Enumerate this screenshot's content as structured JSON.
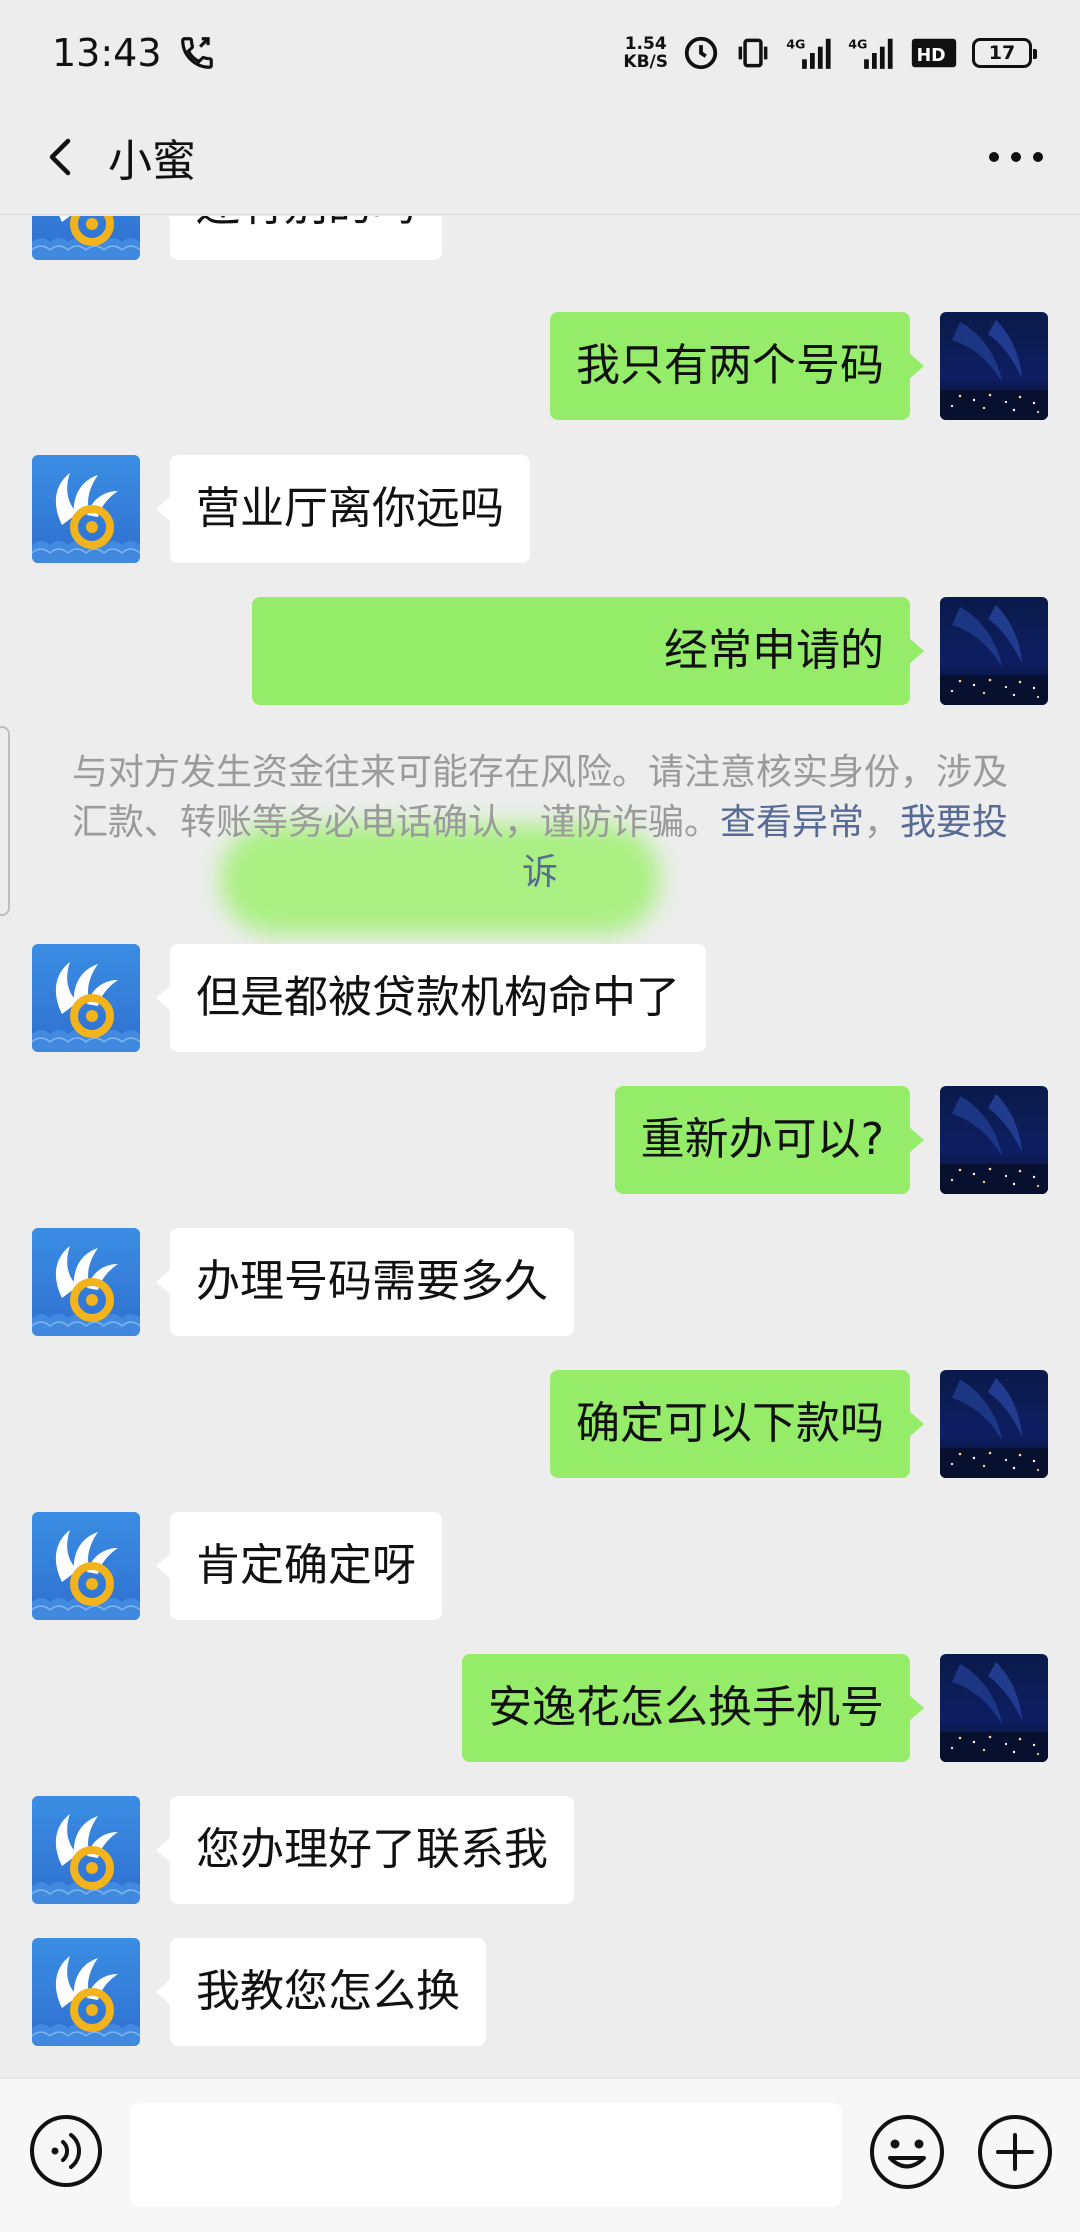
{
  "status_bar": {
    "time": "13:43",
    "net_speed_value": "1.54",
    "net_speed_unit": "KB/S",
    "sim1": "4G",
    "sim2": "4G",
    "hd": "HD",
    "battery": "17"
  },
  "header": {
    "title": "小蜜",
    "back_icon": "chevron-left-icon",
    "more_icon": "ellipsis-icon"
  },
  "messages": [
    {
      "side": "left",
      "text": "还有别的吗"
    },
    {
      "side": "right",
      "text": "我只有两个号码"
    },
    {
      "side": "left",
      "text": "营业厅离你远吗"
    },
    {
      "side": "right",
      "text": "经常申请的",
      "partially_blurred": true
    },
    {
      "side": "left",
      "text": "但是都被贷款机构命中了"
    },
    {
      "side": "right",
      "text": "重新办可以?"
    },
    {
      "side": "left",
      "text": "办理号码需要多久"
    },
    {
      "side": "right",
      "text": "确定可以下款吗"
    },
    {
      "side": "left",
      "text": "肯定确定呀"
    },
    {
      "side": "right",
      "text": "安逸花怎么换手机号"
    },
    {
      "side": "left",
      "text": "您办理好了联系我"
    },
    {
      "side": "left",
      "text": "我教您怎么换"
    }
  ],
  "notice": {
    "text": "与对方发生资金往来可能存在风险。请注意核实身份，涉及汇款、转账等务必电话确认，谨防诈骗。",
    "link1": "查看异常",
    "separator": "，",
    "link2": "我要投诉"
  },
  "input_bar": {
    "placeholder": "",
    "voice_icon": "voice-icon",
    "emoji_icon": "emoji-icon",
    "plus_icon": "plus-icon"
  },
  "colors": {
    "background": "#ededed",
    "my_bubble": "#95ec69",
    "their_bubble": "#ffffff",
    "link": "#576b95",
    "notice_text": "#9b9b9b"
  }
}
